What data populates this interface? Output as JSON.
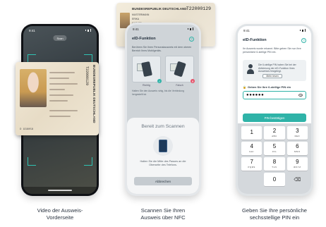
{
  "phone1": {
    "time": "9:41",
    "scan_pill": "Scan",
    "id_card": {
      "heading": "BUNDESREPUBLIK DEUTSCHLAND",
      "number": "T22000129",
      "bottom_code": "D  938058"
    }
  },
  "top_card": {
    "heading": "BUNDESREPUBLIK DEUTSCHLAND",
    "number": "T22000129",
    "lines": [
      "MUSTERMANN",
      "ERIKA",
      "GABLER"
    ]
  },
  "phone2": {
    "time": "9:41",
    "title": "eID-Funktion",
    "description": "Berühren Sie Ihren Personalausweis mit dem oberen Bereich Ihres Mobilgeräts.",
    "illustrations": [
      {
        "label": "Richtig",
        "badge_color": "#2fb3a8",
        "badge": "✓"
      },
      {
        "label": "Falsch",
        "badge_color": "#e5536a",
        "badge": "✕"
      }
    ],
    "body_text": "Halten Sie den Ausweis ruhig, bis die Verbindung hergestellt ist.",
    "sheet": {
      "title": "Bereit zum Scannen",
      "text": "Halten Sie die Mitte des Passes an die Oberseite des Telefons.",
      "cancel": "Abbrechen"
    }
  },
  "phone3": {
    "time": "9:41",
    "title": "eID-Funktion",
    "description": "Ihr Ausweis wurde erkannt. Bitte geben Sie nun Ihre persönliche 6-stellige PIN ein.",
    "info_text": "Die 6-stellige PIN haben Sie bei der Aktivierung der eID-Funktion Ihres Ausweises festgelegt.",
    "more_button": "Mehr lesen",
    "pin_label": "Geben Sie Ihre 6-stellige PIN ein",
    "pin_value": "●●●●●●",
    "confirm_button": "PIN bestätigen",
    "keys": [
      {
        "num": "1",
        "letters": ""
      },
      {
        "num": "2",
        "letters": "ABC"
      },
      {
        "num": "3",
        "letters": "DEF"
      },
      {
        "num": "4",
        "letters": "GHI"
      },
      {
        "num": "5",
        "letters": "JKL"
      },
      {
        "num": "6",
        "letters": "MNO"
      },
      {
        "num": "7",
        "letters": "PQRS"
      },
      {
        "num": "8",
        "letters": "TUV"
      },
      {
        "num": "9",
        "letters": "WXYZ"
      },
      {
        "num": "",
        "letters": ""
      },
      {
        "num": "0",
        "letters": ""
      },
      {
        "num": "⌫",
        "letters": ""
      }
    ]
  },
  "captions": {
    "cap1_line1": "Video der Ausweis-",
    "cap1_line2": "Vorderseite",
    "cap2_line1": "Scannen Sie Ihren",
    "cap2_line2": "Ausweis über NFC",
    "cap3_line1": "Geben Sie Ihre persönliche",
    "cap3_line2": "sechsstellige PIN ein"
  },
  "colors": {
    "accent": "#2fb3a8",
    "error": "#e5536a"
  }
}
